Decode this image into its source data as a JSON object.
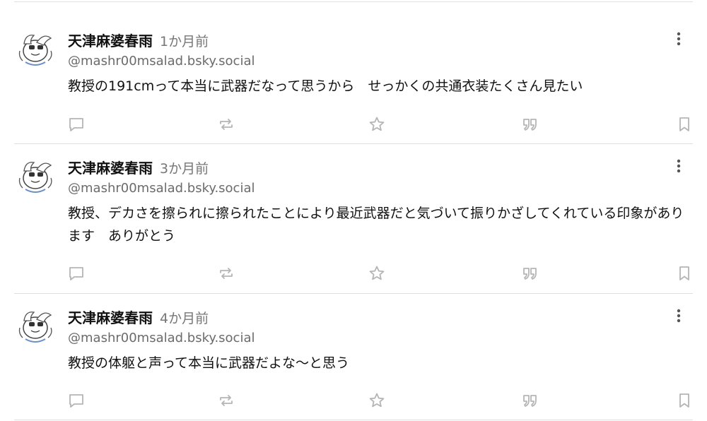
{
  "posts": [
    {
      "author": "天津麻婆春雨",
      "time": "1か月前",
      "handle": "@mashr00msalad.bsky.social",
      "text": "教授の191cmって本当に武器だなって思うから　せっかくの共通衣装たくさん見たい"
    },
    {
      "author": "天津麻婆春雨",
      "time": "3か月前",
      "handle": "@mashr00msalad.bsky.social",
      "text": "教授、デカさを擦られに擦られたことにより最近武器だと気づいて振りかざしてくれている印象があります　ありがとう"
    },
    {
      "author": "天津麻婆春雨",
      "time": "4か月前",
      "handle": "@mashr00msalad.bsky.social",
      "text": "教授の体躯と声って本当に武器だよな〜と思う"
    }
  ],
  "icons": {
    "reply": "reply-icon",
    "repost": "repost-icon",
    "like": "star-icon",
    "quote": "quote-icon",
    "bookmark": "bookmark-icon",
    "more": "more-vertical-icon"
  },
  "colors": {
    "icon": "#b5b5b5",
    "divider": "#dedede",
    "secondary_text": "#6b6b6b"
  }
}
